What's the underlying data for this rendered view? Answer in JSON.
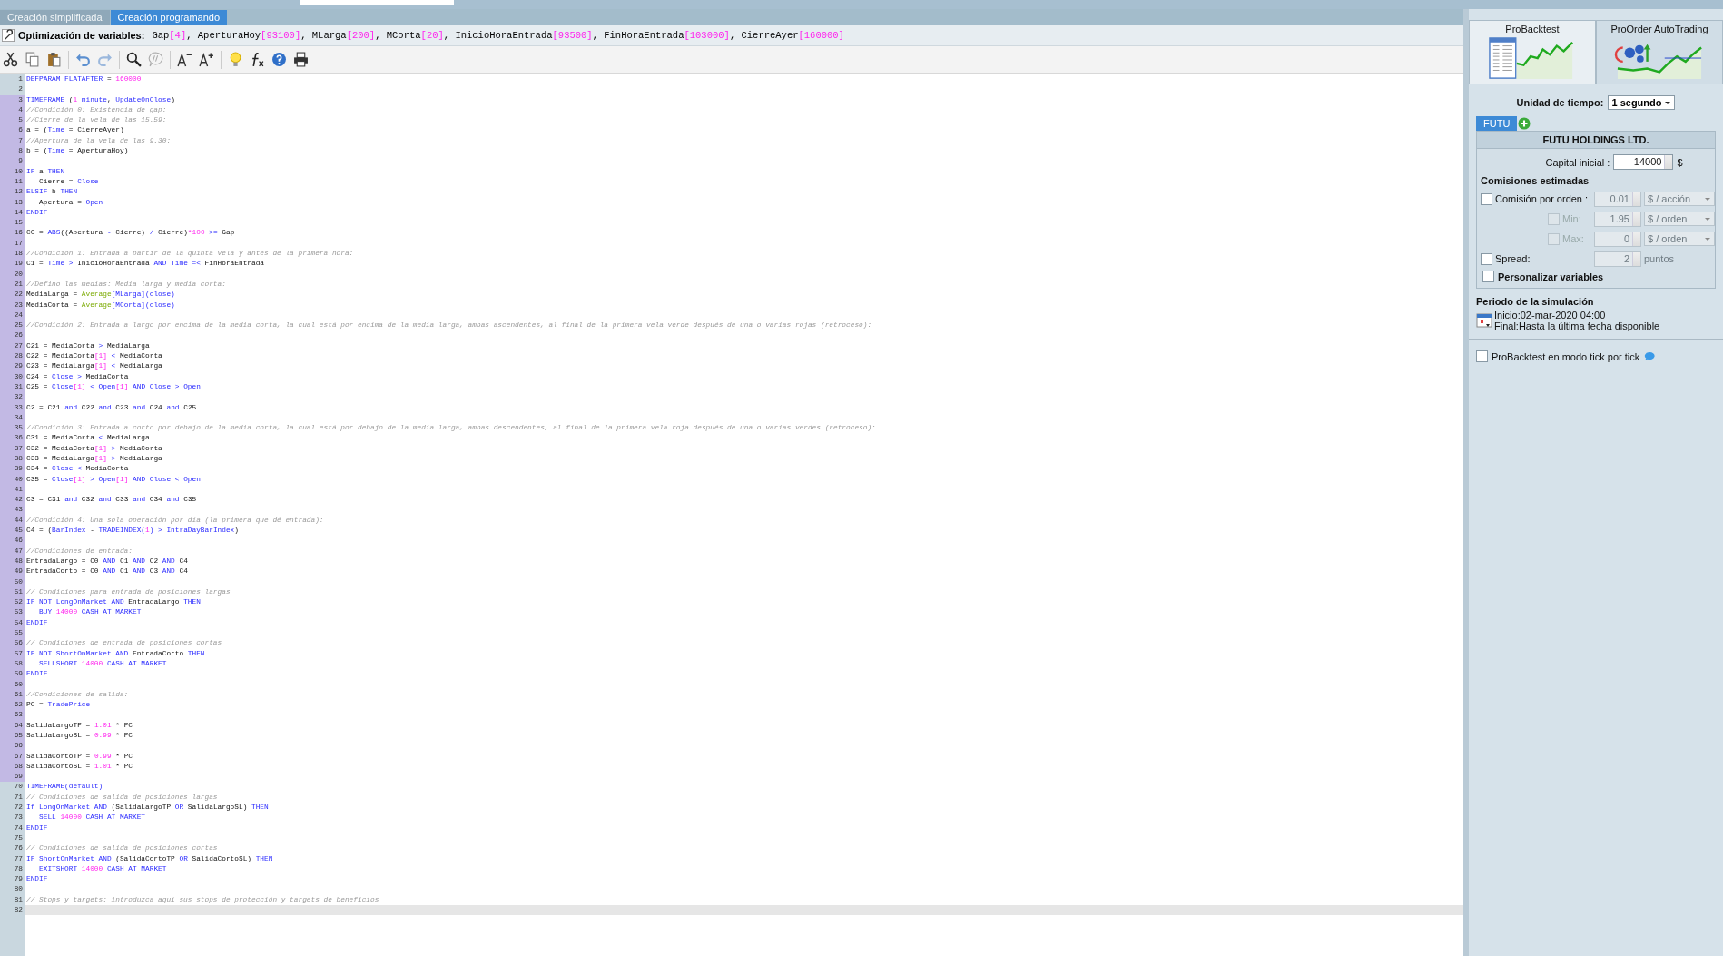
{
  "top_tabs": [
    {
      "label": "Creación simplificada",
      "selected": false
    },
    {
      "label": "Creación programando",
      "selected": true
    }
  ],
  "optimization": {
    "label": "Optimización de variables:",
    "tokens": [
      {
        "text": "Gap"
      },
      {
        "text": "[4]",
        "kind": "num"
      },
      {
        "text": ", AperturaHoy"
      },
      {
        "text": "[93100]",
        "kind": "num"
      },
      {
        "text": ", MLarga"
      },
      {
        "text": "[200]",
        "kind": "num"
      },
      {
        "text": ", MCorta"
      },
      {
        "text": "[20]",
        "kind": "num"
      },
      {
        "text": ", InicioHoraEntrada"
      },
      {
        "text": "[93500]",
        "kind": "num"
      },
      {
        "text": ", FinHoraEntrada"
      },
      {
        "text": "[103000]",
        "kind": "num"
      },
      {
        "text": ", CierreAyer"
      },
      {
        "text": "[160000]",
        "kind": "num"
      }
    ]
  },
  "toolbar": [
    {
      "kind": "cut"
    },
    {
      "kind": "copy"
    },
    {
      "kind": "paste"
    },
    {
      "kind": "sep"
    },
    {
      "kind": "undo"
    },
    {
      "kind": "redo"
    },
    {
      "kind": "sep"
    },
    {
      "kind": "search"
    },
    {
      "kind": "comment"
    },
    {
      "kind": "sep"
    },
    {
      "kind": "font-smaller"
    },
    {
      "kind": "font-larger"
    },
    {
      "kind": "sep"
    },
    {
      "kind": "bulb"
    },
    {
      "kind": "function"
    },
    {
      "kind": "help"
    },
    {
      "kind": "print"
    }
  ],
  "code": {
    "lines": [
      {
        "n": "1",
        "marked": false,
        "current": false,
        "tokens": [
          {
            "text": "DEFPARAM FLATAFTER",
            "kind": "kw"
          },
          {
            "text": " = "
          },
          {
            "text": "160000",
            "kind": "num"
          }
        ]
      },
      {
        "n": "2",
        "marked": false,
        "current": false
      },
      {
        "n": "3",
        "marked": true,
        "current": false,
        "tokens": [
          {
            "text": "TIMEFRAME",
            "kind": "kw"
          },
          {
            "text": " ("
          },
          {
            "text": "1",
            "kind": "num"
          },
          {
            "text": " minute",
            "kind": "kw"
          },
          {
            "text": ", "
          },
          {
            "text": "UpdateOnClose",
            "kind": "kw"
          },
          {
            "text": ")"
          }
        ]
      },
      {
        "n": "4",
        "marked": true,
        "current": false,
        "tokens": [
          {
            "text": "//Condición 0: Existencia de gap:",
            "kind": "cm"
          }
        ]
      },
      {
        "n": "5",
        "marked": true,
        "current": false,
        "tokens": [
          {
            "text": "//Cierre de la vela de las 15.59:",
            "kind": "cm"
          }
        ]
      },
      {
        "n": "6",
        "marked": true,
        "current": false,
        "tokens": [
          {
            "text": "a = ("
          },
          {
            "text": "Time",
            "kind": "kw"
          },
          {
            "text": " = CierreAyer)"
          }
        ]
      },
      {
        "n": "7",
        "marked": true,
        "current": false,
        "tokens": [
          {
            "text": "//Apertura de la vela de las 9.30:",
            "kind": "cm"
          }
        ]
      },
      {
        "n": "8",
        "marked": true,
        "current": false,
        "tokens": [
          {
            "text": "b = ("
          },
          {
            "text": "Time",
            "kind": "kw"
          },
          {
            "text": " = AperturaHoy)"
          }
        ]
      },
      {
        "n": "9",
        "marked": true,
        "current": false
      },
      {
        "n": "10",
        "marked": true,
        "current": false,
        "tokens": [
          {
            "text": "IF",
            "kind": "kw"
          },
          {
            "text": " a "
          },
          {
            "text": "THEN",
            "kind": "kw"
          }
        ]
      },
      {
        "n": "11",
        "marked": true,
        "current": false,
        "tokens": [
          {
            "text": "   Cierre = "
          },
          {
            "text": "Close",
            "kind": "kw"
          }
        ]
      },
      {
        "n": "12",
        "marked": true,
        "current": false,
        "tokens": [
          {
            "text": "ELSIF",
            "kind": "kw"
          },
          {
            "text": " b "
          },
          {
            "text": "THEN",
            "kind": "kw"
          }
        ]
      },
      {
        "n": "13",
        "marked": true,
        "current": false,
        "tokens": [
          {
            "text": "   Apertura = "
          },
          {
            "text": "Open",
            "kind": "kw"
          }
        ]
      },
      {
        "n": "14",
        "marked": true,
        "current": false,
        "tokens": [
          {
            "text": "ENDIF",
            "kind": "kw"
          }
        ]
      },
      {
        "n": "15",
        "marked": true,
        "current": false
      },
      {
        "n": "16",
        "marked": true,
        "current": false,
        "tokens": [
          {
            "text": "C0 = "
          },
          {
            "text": "ABS",
            "kind": "kw"
          },
          {
            "text": "((Apertura "
          },
          {
            "text": "-",
            "kind": "kw"
          },
          {
            "text": " Cierre) "
          },
          {
            "text": "/",
            "kind": "kw"
          },
          {
            "text": " Cierre)"
          },
          {
            "text": "*100",
            "kind": "num"
          },
          {
            "text": " >=",
            "kind": "kw"
          },
          {
            "text": " Gap"
          }
        ]
      },
      {
        "n": "17",
        "marked": true,
        "current": false
      },
      {
        "n": "18",
        "marked": true,
        "current": false,
        "tokens": [
          {
            "text": "//Condición 1: Entrada a partir de la quinta vela y antes de la primera hora:",
            "kind": "cm"
          }
        ]
      },
      {
        "n": "19",
        "marked": true,
        "current": false,
        "tokens": [
          {
            "text": "C1 = "
          },
          {
            "text": "Time >",
            "kind": "kw"
          },
          {
            "text": " InicioHoraEntrada "
          },
          {
            "text": "AND Time =<",
            "kind": "kw"
          },
          {
            "text": " FinHoraEntrada"
          }
        ]
      },
      {
        "n": "20",
        "marked": true,
        "current": false
      },
      {
        "n": "21",
        "marked": true,
        "current": false,
        "tokens": [
          {
            "text": "//Defino las medias: Media larga y media corta:",
            "kind": "cm"
          }
        ]
      },
      {
        "n": "22",
        "marked": true,
        "current": false,
        "tokens": [
          {
            "text": "MediaLarga = "
          },
          {
            "text": "Average",
            "kind": "fn"
          },
          {
            "text": "[MLarga](close)",
            "kind": "kw"
          }
        ]
      },
      {
        "n": "23",
        "marked": true,
        "current": false,
        "tokens": [
          {
            "text": "MediaCorta = "
          },
          {
            "text": "Average",
            "kind": "fn"
          },
          {
            "text": "[MCorta](close)",
            "kind": "kw"
          }
        ]
      },
      {
        "n": "24",
        "marked": true,
        "current": false
      },
      {
        "n": "25",
        "marked": true,
        "current": false,
        "tokens": [
          {
            "text": "//Condición 2: Entrada a largo por encima de la media corta, la cual está por encima de la media larga, ambas ascendentes, al final de la primera vela verde después de una o varias rojas (retroceso):",
            "kind": "cm"
          }
        ]
      },
      {
        "n": "26",
        "marked": true,
        "current": false
      },
      {
        "n": "27",
        "marked": true,
        "current": false,
        "tokens": [
          {
            "text": "C21 = MediaCorta "
          },
          {
            "text": ">",
            "kind": "kw"
          },
          {
            "text": " MediaLarga"
          }
        ]
      },
      {
        "n": "28",
        "marked": true,
        "current": false,
        "tokens": [
          {
            "text": "C22 = MediaCorta"
          },
          {
            "text": "[1]",
            "kind": "num"
          },
          {
            "text": " <",
            "kind": "kw"
          },
          {
            "text": " MediaCorta"
          }
        ]
      },
      {
        "n": "29",
        "marked": true,
        "current": false,
        "tokens": [
          {
            "text": "C23 = MediaLarga"
          },
          {
            "text": "[1]",
            "kind": "num"
          },
          {
            "text": " <",
            "kind": "kw"
          },
          {
            "text": " MediaLarga"
          }
        ]
      },
      {
        "n": "30",
        "marked": true,
        "current": false,
        "tokens": [
          {
            "text": "C24 = "
          },
          {
            "text": "Close >",
            "kind": "kw"
          },
          {
            "text": " MediaCorta"
          }
        ]
      },
      {
        "n": "31",
        "marked": true,
        "current": false,
        "tokens": [
          {
            "text": "C25 = "
          },
          {
            "text": "Close",
            "kind": "kw"
          },
          {
            "text": "[1]",
            "kind": "num"
          },
          {
            "text": " < Open",
            "kind": "kw"
          },
          {
            "text": "[1]",
            "kind": "num"
          },
          {
            "text": " AND Close > Open",
            "kind": "kw"
          }
        ]
      },
      {
        "n": "32",
        "marked": true,
        "current": false
      },
      {
        "n": "33",
        "marked": true,
        "current": false,
        "tokens": [
          {
            "text": "C2 = C21 "
          },
          {
            "text": "and",
            "kind": "kw"
          },
          {
            "text": " C22 "
          },
          {
            "text": "and",
            "kind": "kw"
          },
          {
            "text": " C23 "
          },
          {
            "text": "and",
            "kind": "kw"
          },
          {
            "text": " C24 "
          },
          {
            "text": "and",
            "kind": "kw"
          },
          {
            "text": " C25"
          }
        ]
      },
      {
        "n": "34",
        "marked": true,
        "current": false
      },
      {
        "n": "35",
        "marked": true,
        "current": false,
        "tokens": [
          {
            "text": "//Condición 3: Entrada a corto por debajo de la media corta, la cual está por debajo de la media larga, ambas descendentes, al final de la primera vela roja después de una o varias verdes (retroceso):",
            "kind": "cm"
          }
        ]
      },
      {
        "n": "36",
        "marked": true,
        "current": false,
        "tokens": [
          {
            "text": "C31 = MediaCorta "
          },
          {
            "text": "<",
            "kind": "kw"
          },
          {
            "text": " MediaLarga"
          }
        ]
      },
      {
        "n": "37",
        "marked": true,
        "current": false,
        "tokens": [
          {
            "text": "C32 = MediaCorta"
          },
          {
            "text": "[1]",
            "kind": "num"
          },
          {
            "text": " >",
            "kind": "kw"
          },
          {
            "text": " MediaCorta"
          }
        ]
      },
      {
        "n": "38",
        "marked": true,
        "current": false,
        "tokens": [
          {
            "text": "C33 = MediaLarga"
          },
          {
            "text": "[1]",
            "kind": "num"
          },
          {
            "text": " >",
            "kind": "kw"
          },
          {
            "text": " MediaLarga"
          }
        ]
      },
      {
        "n": "39",
        "marked": true,
        "current": false,
        "tokens": [
          {
            "text": "C34 = "
          },
          {
            "text": "Close <",
            "kind": "kw"
          },
          {
            "text": " MediaCorta"
          }
        ]
      },
      {
        "n": "40",
        "marked": true,
        "current": false,
        "tokens": [
          {
            "text": "C35 = "
          },
          {
            "text": "Close",
            "kind": "kw"
          },
          {
            "text": "[1]",
            "kind": "num"
          },
          {
            "text": " > Open",
            "kind": "kw"
          },
          {
            "text": "[1]",
            "kind": "num"
          },
          {
            "text": " AND Close < Open",
            "kind": "kw"
          }
        ]
      },
      {
        "n": "41",
        "marked": true,
        "current": false
      },
      {
        "n": "42",
        "marked": true,
        "current": false,
        "tokens": [
          {
            "text": "C3 = C31 "
          },
          {
            "text": "and",
            "kind": "kw"
          },
          {
            "text": " C32 "
          },
          {
            "text": "and",
            "kind": "kw"
          },
          {
            "text": " C33 "
          },
          {
            "text": "and",
            "kind": "kw"
          },
          {
            "text": " C34 "
          },
          {
            "text": "and",
            "kind": "kw"
          },
          {
            "text": " C35"
          }
        ]
      },
      {
        "n": "43",
        "marked": true,
        "current": false
      },
      {
        "n": "44",
        "marked": true,
        "current": false,
        "tokens": [
          {
            "text": "//Condición 4: Una sola operación por día (la primera que dé entrada):",
            "kind": "cm"
          }
        ]
      },
      {
        "n": "45",
        "marked": true,
        "current": false,
        "tokens": [
          {
            "text": "C4 = ("
          },
          {
            "text": "BarIndex",
            "kind": "kw"
          },
          {
            "text": " - "
          },
          {
            "text": "TRADEINDEX(",
            "kind": "kw"
          },
          {
            "text": "1",
            "kind": "num"
          },
          {
            "text": ") > IntraDayBarIndex",
            "kind": "kw"
          },
          {
            "text": ")"
          }
        ]
      },
      {
        "n": "46",
        "marked": true,
        "current": false
      },
      {
        "n": "47",
        "marked": true,
        "current": false,
        "tokens": [
          {
            "text": "//Condiciones de entrada:",
            "kind": "cm"
          }
        ]
      },
      {
        "n": "48",
        "marked": true,
        "current": false,
        "tokens": [
          {
            "text": "EntradaLargo = C0 "
          },
          {
            "text": "AND",
            "kind": "kw"
          },
          {
            "text": " C1 "
          },
          {
            "text": "AND",
            "kind": "kw"
          },
          {
            "text": " C2 "
          },
          {
            "text": "AND",
            "kind": "kw"
          },
          {
            "text": " C4"
          }
        ]
      },
      {
        "n": "49",
        "marked": true,
        "current": false,
        "tokens": [
          {
            "text": "EntradaCorto = C0 "
          },
          {
            "text": "AND",
            "kind": "kw"
          },
          {
            "text": " C1 "
          },
          {
            "text": "AND",
            "kind": "kw"
          },
          {
            "text": " C3 "
          },
          {
            "text": "AND",
            "kind": "kw"
          },
          {
            "text": " C4"
          }
        ]
      },
      {
        "n": "50",
        "marked": true,
        "current": false
      },
      {
        "n": "51",
        "marked": true,
        "current": false,
        "tokens": [
          {
            "text": "// Condiciones para entrada de posiciones largas",
            "kind": "cm"
          }
        ]
      },
      {
        "n": "52",
        "marked": true,
        "current": false,
        "tokens": [
          {
            "text": "IF NOT LongOnMarket AND",
            "kind": "kw"
          },
          {
            "text": " EntradaLargo "
          },
          {
            "text": "THEN",
            "kind": "kw"
          }
        ]
      },
      {
        "n": "53",
        "marked": true,
        "current": false,
        "tokens": [
          {
            "text": "   BUY ",
            "kind": "kw"
          },
          {
            "text": "14000",
            "kind": "num"
          },
          {
            "text": " CASH AT MARKET",
            "kind": "kw"
          }
        ]
      },
      {
        "n": "54",
        "marked": true,
        "current": false,
        "tokens": [
          {
            "text": "ENDIF",
            "kind": "kw"
          }
        ]
      },
      {
        "n": "55",
        "marked": true,
        "current": false
      },
      {
        "n": "56",
        "marked": true,
        "current": false,
        "tokens": [
          {
            "text": "// Condiciones de entrada de posiciones cortas",
            "kind": "cm"
          }
        ]
      },
      {
        "n": "57",
        "marked": true,
        "current": false,
        "tokens": [
          {
            "text": "IF NOT ShortOnMarket AND",
            "kind": "kw"
          },
          {
            "text": " EntradaCorto "
          },
          {
            "text": "THEN",
            "kind": "kw"
          }
        ]
      },
      {
        "n": "58",
        "marked": true,
        "current": false,
        "tokens": [
          {
            "text": "   SELLSHORT ",
            "kind": "kw"
          },
          {
            "text": "14000",
            "kind": "num"
          },
          {
            "text": " CASH AT MARKET",
            "kind": "kw"
          }
        ]
      },
      {
        "n": "59",
        "marked": true,
        "current": false,
        "tokens": [
          {
            "text": "ENDIF",
            "kind": "kw"
          }
        ]
      },
      {
        "n": "60",
        "marked": true,
        "current": false
      },
      {
        "n": "61",
        "marked": true,
        "current": false,
        "tokens": [
          {
            "text": "//Condiciones de salida:",
            "kind": "cm"
          }
        ]
      },
      {
        "n": "62",
        "marked": true,
        "current": false,
        "tokens": [
          {
            "text": "PC = "
          },
          {
            "text": "TradePrice",
            "kind": "kw"
          }
        ]
      },
      {
        "n": "63",
        "marked": true,
        "current": false
      },
      {
        "n": "64",
        "marked": true,
        "current": false,
        "tokens": [
          {
            "text": "SalidaLargoTP = "
          },
          {
            "text": "1.01",
            "kind": "num"
          },
          {
            "text": " * PC"
          }
        ]
      },
      {
        "n": "65",
        "marked": true,
        "current": false,
        "tokens": [
          {
            "text": "SalidaLargoSL = "
          },
          {
            "text": "0.99",
            "kind": "num"
          },
          {
            "text": " * PC"
          }
        ]
      },
      {
        "n": "66",
        "marked": true,
        "current": false
      },
      {
        "n": "67",
        "marked": true,
        "current": false,
        "tokens": [
          {
            "text": "SalidaCortoTP = "
          },
          {
            "text": "0.99",
            "kind": "num"
          },
          {
            "text": " * PC"
          }
        ]
      },
      {
        "n": "68",
        "marked": true,
        "current": false,
        "tokens": [
          {
            "text": "SalidaCortoSL = "
          },
          {
            "text": "1.01",
            "kind": "num"
          },
          {
            "text": " * PC"
          }
        ]
      },
      {
        "n": "69",
        "marked": true,
        "current": false
      },
      {
        "n": "70",
        "marked": false,
        "current": false,
        "tokens": [
          {
            "text": "TIMEFRAME(default)",
            "kind": "kw"
          }
        ]
      },
      {
        "n": "71",
        "marked": false,
        "current": false,
        "tokens": [
          {
            "text": "// Condiciones de salida de posiciones largas",
            "kind": "cm"
          }
        ]
      },
      {
        "n": "72",
        "marked": false,
        "current": false,
        "tokens": [
          {
            "text": "If LongOnMarket AND",
            "kind": "kw"
          },
          {
            "text": " (SalidaLargoTP "
          },
          {
            "text": "OR",
            "kind": "kw"
          },
          {
            "text": " SalidaLargoSL) "
          },
          {
            "text": "THEN",
            "kind": "kw"
          }
        ]
      },
      {
        "n": "73",
        "marked": false,
        "current": false,
        "tokens": [
          {
            "text": "   SELL ",
            "kind": "kw"
          },
          {
            "text": "14000",
            "kind": "num"
          },
          {
            "text": " CASH AT MARKET",
            "kind": "kw"
          }
        ]
      },
      {
        "n": "74",
        "marked": false,
        "current": false,
        "tokens": [
          {
            "text": "ENDIF",
            "kind": "kw"
          }
        ]
      },
      {
        "n": "75",
        "marked": false,
        "current": false
      },
      {
        "n": "76",
        "marked": false,
        "current": false,
        "tokens": [
          {
            "text": "// Condiciones de salida de posiciones cortas",
            "kind": "cm"
          }
        ]
      },
      {
        "n": "77",
        "marked": false,
        "current": false,
        "tokens": [
          {
            "text": "IF ShortOnMarket AND",
            "kind": "kw"
          },
          {
            "text": " (SalidaCortoTP "
          },
          {
            "text": "OR",
            "kind": "kw"
          },
          {
            "text": " SalidaCortoSL) "
          },
          {
            "text": "THEN",
            "kind": "kw"
          }
        ]
      },
      {
        "n": "78",
        "marked": false,
        "current": false,
        "tokens": [
          {
            "text": "   EXITSHORT ",
            "kind": "kw"
          },
          {
            "text": "14000",
            "kind": "num"
          },
          {
            "text": " CASH AT MARKET",
            "kind": "kw"
          }
        ]
      },
      {
        "n": "79",
        "marked": false,
        "current": false,
        "tokens": [
          {
            "text": "ENDIF",
            "kind": "kw"
          }
        ]
      },
      {
        "n": "80",
        "marked": false,
        "current": false
      },
      {
        "n": "81",
        "marked": false,
        "current": false,
        "tokens": [
          {
            "text": "// Stops y targets: introduzca aquí sus stops de protección y targets de beneficios",
            "kind": "cm"
          }
        ]
      },
      {
        "n": "82",
        "marked": false,
        "current": true
      }
    ]
  },
  "side_panel": {
    "modes": [
      {
        "label": "ProBacktest",
        "kind": "backtest",
        "selected": true
      },
      {
        "label": "ProOrder AutoTrading",
        "kind": "autotrading",
        "selected": false
      }
    ],
    "timeframe": {
      "label": "Unidad de tiempo:",
      "value": "1 segundo"
    },
    "instrument_tab": {
      "label": "FUTU",
      "selected": true
    },
    "instrument_name": "FUTU HOLDINGS LTD.",
    "capital": {
      "label": "Capital inicial :",
      "value": "14000",
      "unit": "$"
    },
    "commissions_title": "Comisiones estimadas",
    "commissions": [
      {
        "kind": "main",
        "label": "Comisión por orden :",
        "checked": false,
        "disabled": false,
        "value": "0.01",
        "unit": "$ / acción"
      },
      {
        "kind": "sub",
        "label": "Min:",
        "checked": false,
        "disabled": true,
        "value": "1.95",
        "unit": "$ / orden"
      },
      {
        "kind": "sub",
        "label": "Max:",
        "checked": false,
        "disabled": true,
        "value": "0",
        "unit": "$ / orden"
      }
    ],
    "spread": {
      "label": "Spread:",
      "checked": false,
      "value": "2",
      "unit": "puntos"
    },
    "personalize": {
      "label": "Personalizar variables",
      "checked": false
    },
    "period": {
      "title": "Periodo de la simulación",
      "start": "Inicio:02-mar-2020 04:00",
      "end": "Final:Hasta la última fecha disponible"
    },
    "tick_mode": {
      "label": "ProBacktest en modo tick por tick",
      "checked": false
    }
  }
}
